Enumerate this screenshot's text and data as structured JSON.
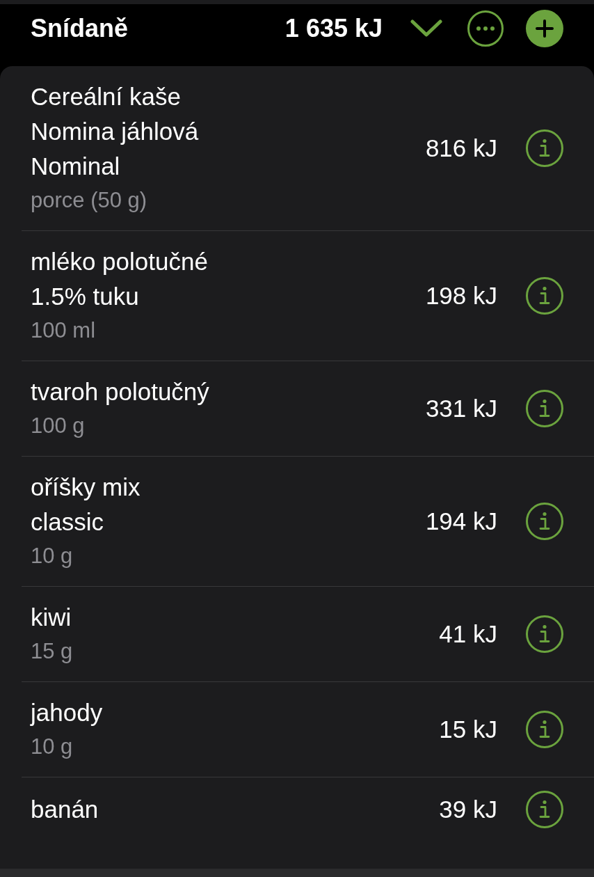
{
  "header": {
    "title": "Snídaně",
    "total": "1 635 kJ"
  },
  "items": [
    {
      "name": "Cereální kaše\nNomina jáhlová\nNominal",
      "amount": "porce (50 g)",
      "energy": "816 kJ"
    },
    {
      "name": "mléko polotučné\n1.5% tuku",
      "amount": "100 ml",
      "energy": "198 kJ"
    },
    {
      "name": "tvaroh polotučný",
      "amount": "100 g",
      "energy": "331 kJ"
    },
    {
      "name": "oříšky mix\nclassic",
      "amount": "10 g",
      "energy": "194 kJ"
    },
    {
      "name": "kiwi",
      "amount": "15 g",
      "energy": "41 kJ"
    },
    {
      "name": "jahody",
      "amount": "10 g",
      "energy": "15 kJ"
    },
    {
      "name": "banán",
      "energy": "39 kJ"
    }
  ]
}
